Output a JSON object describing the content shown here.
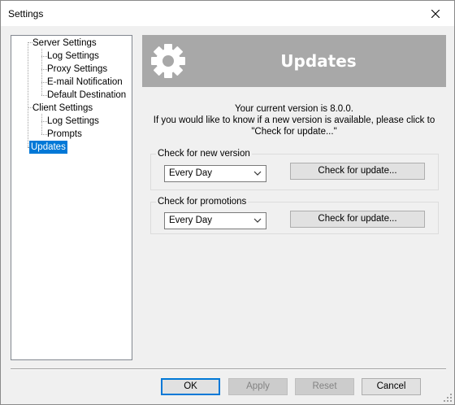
{
  "window": {
    "title": "Settings"
  },
  "tree": {
    "items": [
      {
        "label": "Server Settings",
        "depth": 0
      },
      {
        "label": "Log Settings",
        "depth": 1
      },
      {
        "label": "Proxy Settings",
        "depth": 1
      },
      {
        "label": "E-mail Notification",
        "depth": 1
      },
      {
        "label": "Default Destination",
        "depth": 1
      },
      {
        "label": "Client Settings",
        "depth": 0
      },
      {
        "label": "Log Settings",
        "depth": 1
      },
      {
        "label": "Prompts",
        "depth": 1
      },
      {
        "label": "Updates",
        "depth": 0,
        "selected": true
      }
    ]
  },
  "banner": {
    "title": "Updates",
    "icon": "gear-icon"
  },
  "version": {
    "line1": "Your current version is 8.0.0.",
    "line2": "If you would like to know if a new version is available, please click to",
    "line3": "\"Check for update...\""
  },
  "new_version_group": {
    "label": "Check for new version",
    "frequency": "Every Day",
    "button": "Check for update..."
  },
  "promotions_group": {
    "label": "Check for promotions",
    "frequency": "Every Day",
    "button": "Check for update..."
  },
  "footer": {
    "ok": "OK",
    "apply": "Apply",
    "reset": "Reset",
    "cancel": "Cancel"
  },
  "colors": {
    "selection": "#0078d7",
    "banner": "#a8a8a8",
    "window": "#f0f0f0"
  }
}
